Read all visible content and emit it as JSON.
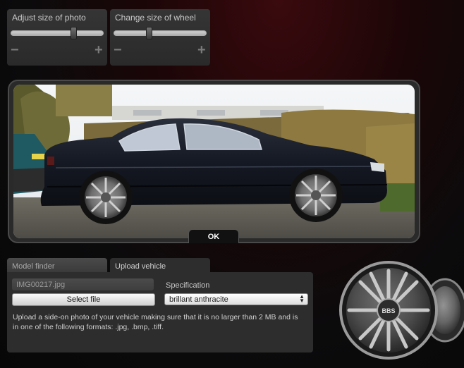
{
  "photo_slider": {
    "label": "Adjust size of photo",
    "minus": "−",
    "plus": "+",
    "value_fraction": 0.69
  },
  "wheel_slider": {
    "label": "Change size of wheel",
    "minus": "−",
    "plus": "+",
    "value_fraction": 0.37
  },
  "preview": {
    "ok_label": "OK"
  },
  "tabs": [
    {
      "label": "Model finder",
      "active": false
    },
    {
      "label": "Upload vehicle",
      "active": true
    }
  ],
  "upload": {
    "filename": "IMG00217.jpg",
    "select_button": "Select file",
    "spec_label": "Specification",
    "spec_value": "brillant anthracite",
    "help_text": "Upload a side-on photo of your vehicle making sure that it is no larger than 2 MB and is in one of the following formats: .jpg, .bmp, .tiff."
  },
  "brand_logo": "BBS",
  "colors": {
    "panel_bg": "#2d2d2d",
    "accent_red": "#3a0a0e"
  }
}
